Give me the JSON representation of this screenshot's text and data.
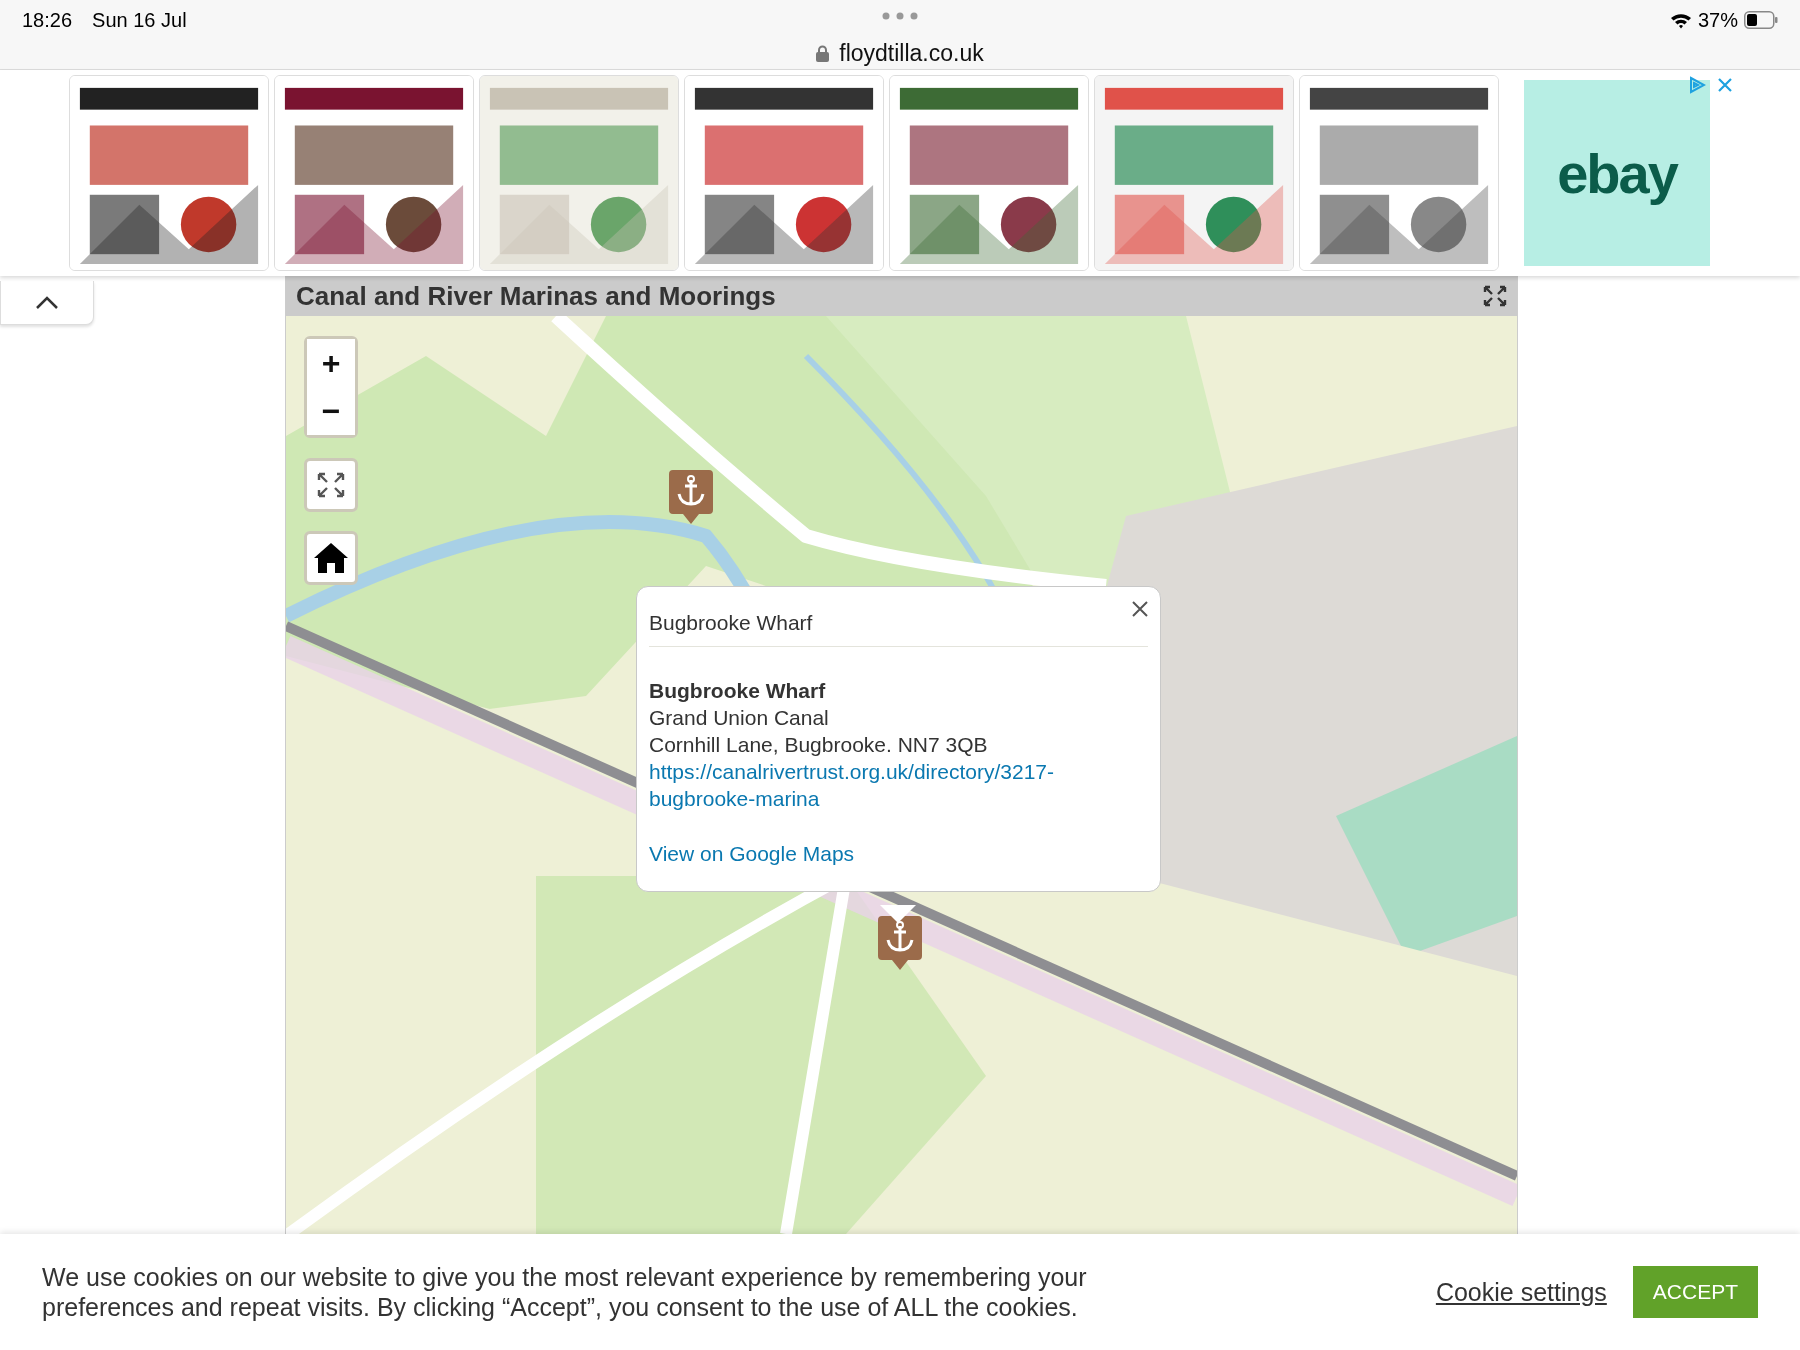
{
  "status_bar": {
    "time": "18:26",
    "date": "Sun 16 Jul",
    "battery": "37%"
  },
  "address_bar": {
    "url": "floydtilla.co.uk"
  },
  "ad_strip": {
    "sponsor": "ebay"
  },
  "map_panel": {
    "title": "Canal and River Marinas and Moorings",
    "zoom_in": "+",
    "zoom_out": "−",
    "popup": {
      "title": "Bugbrooke Wharf",
      "name": "Bugbrooke Wharf",
      "lines": [
        "Grand Union Canal",
        "Cornhill Lane, Bugbrooke. NN7 3QB"
      ],
      "link": "https://canalrivertrust.org.uk/directory/3217-bugbrooke-marina",
      "maps_link": "View on Google Maps"
    }
  },
  "cookie_bar": {
    "text": "We use cookies on our website to give you the most relevant experience by remembering your preferences and repeat visits. By clicking “Accept”, you consent to the use of ALL the cookies.",
    "settings": "Cookie settings",
    "accept": "ACCEPT"
  }
}
